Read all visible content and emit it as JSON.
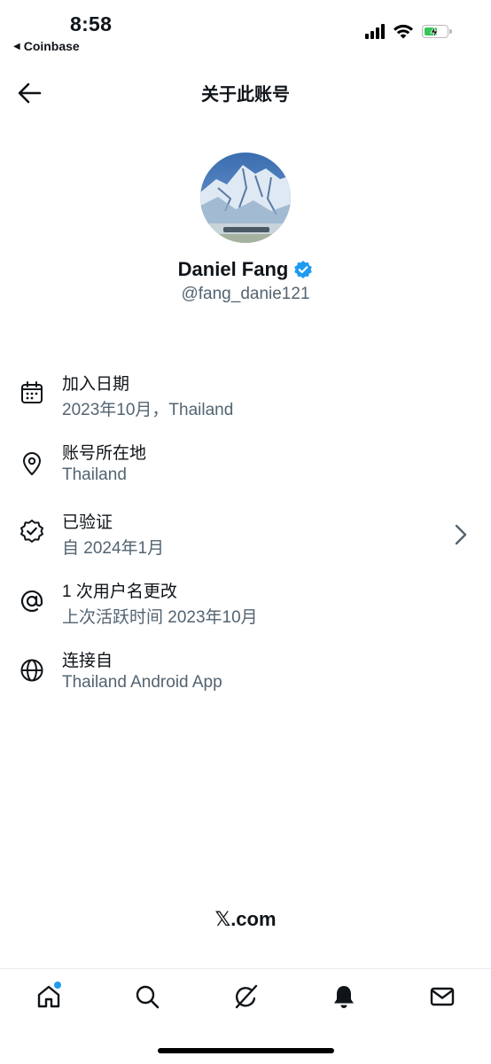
{
  "status_bar": {
    "time": "8:58",
    "back_app": "Coinbase"
  },
  "header": {
    "title": "关于此账号"
  },
  "profile": {
    "name": "Daniel Fang",
    "handle": "@fang_danie121",
    "verified_color": "#1d9bf0"
  },
  "info": [
    {
      "icon": "calendar-icon",
      "title": "加入日期",
      "subtitle": "2023年10月，Thailand"
    },
    {
      "icon": "location-pin-icon",
      "title": "账号所在地",
      "subtitle": "Thailand"
    },
    {
      "icon": "verified-badge-icon",
      "title": "已验证",
      "subtitle": "自 2024年1月"
    },
    {
      "icon": "at-sign-icon",
      "title": "1 次用户名更改",
      "subtitle": "上次活跃时间 2023年10月"
    },
    {
      "icon": "globe-icon",
      "title": "连接自",
      "subtitle": "Thailand Android App"
    }
  ],
  "footer": {
    "brand_x": "𝕏",
    "brand_domain": ".com"
  },
  "tabs": [
    "home-icon",
    "search-icon",
    "grok-icon",
    "notifications-icon",
    "messages-icon"
  ],
  "colors": {
    "text": "#0f1419",
    "secondary": "#536471",
    "accent": "#1d9bf0",
    "battery": "#34c759"
  }
}
